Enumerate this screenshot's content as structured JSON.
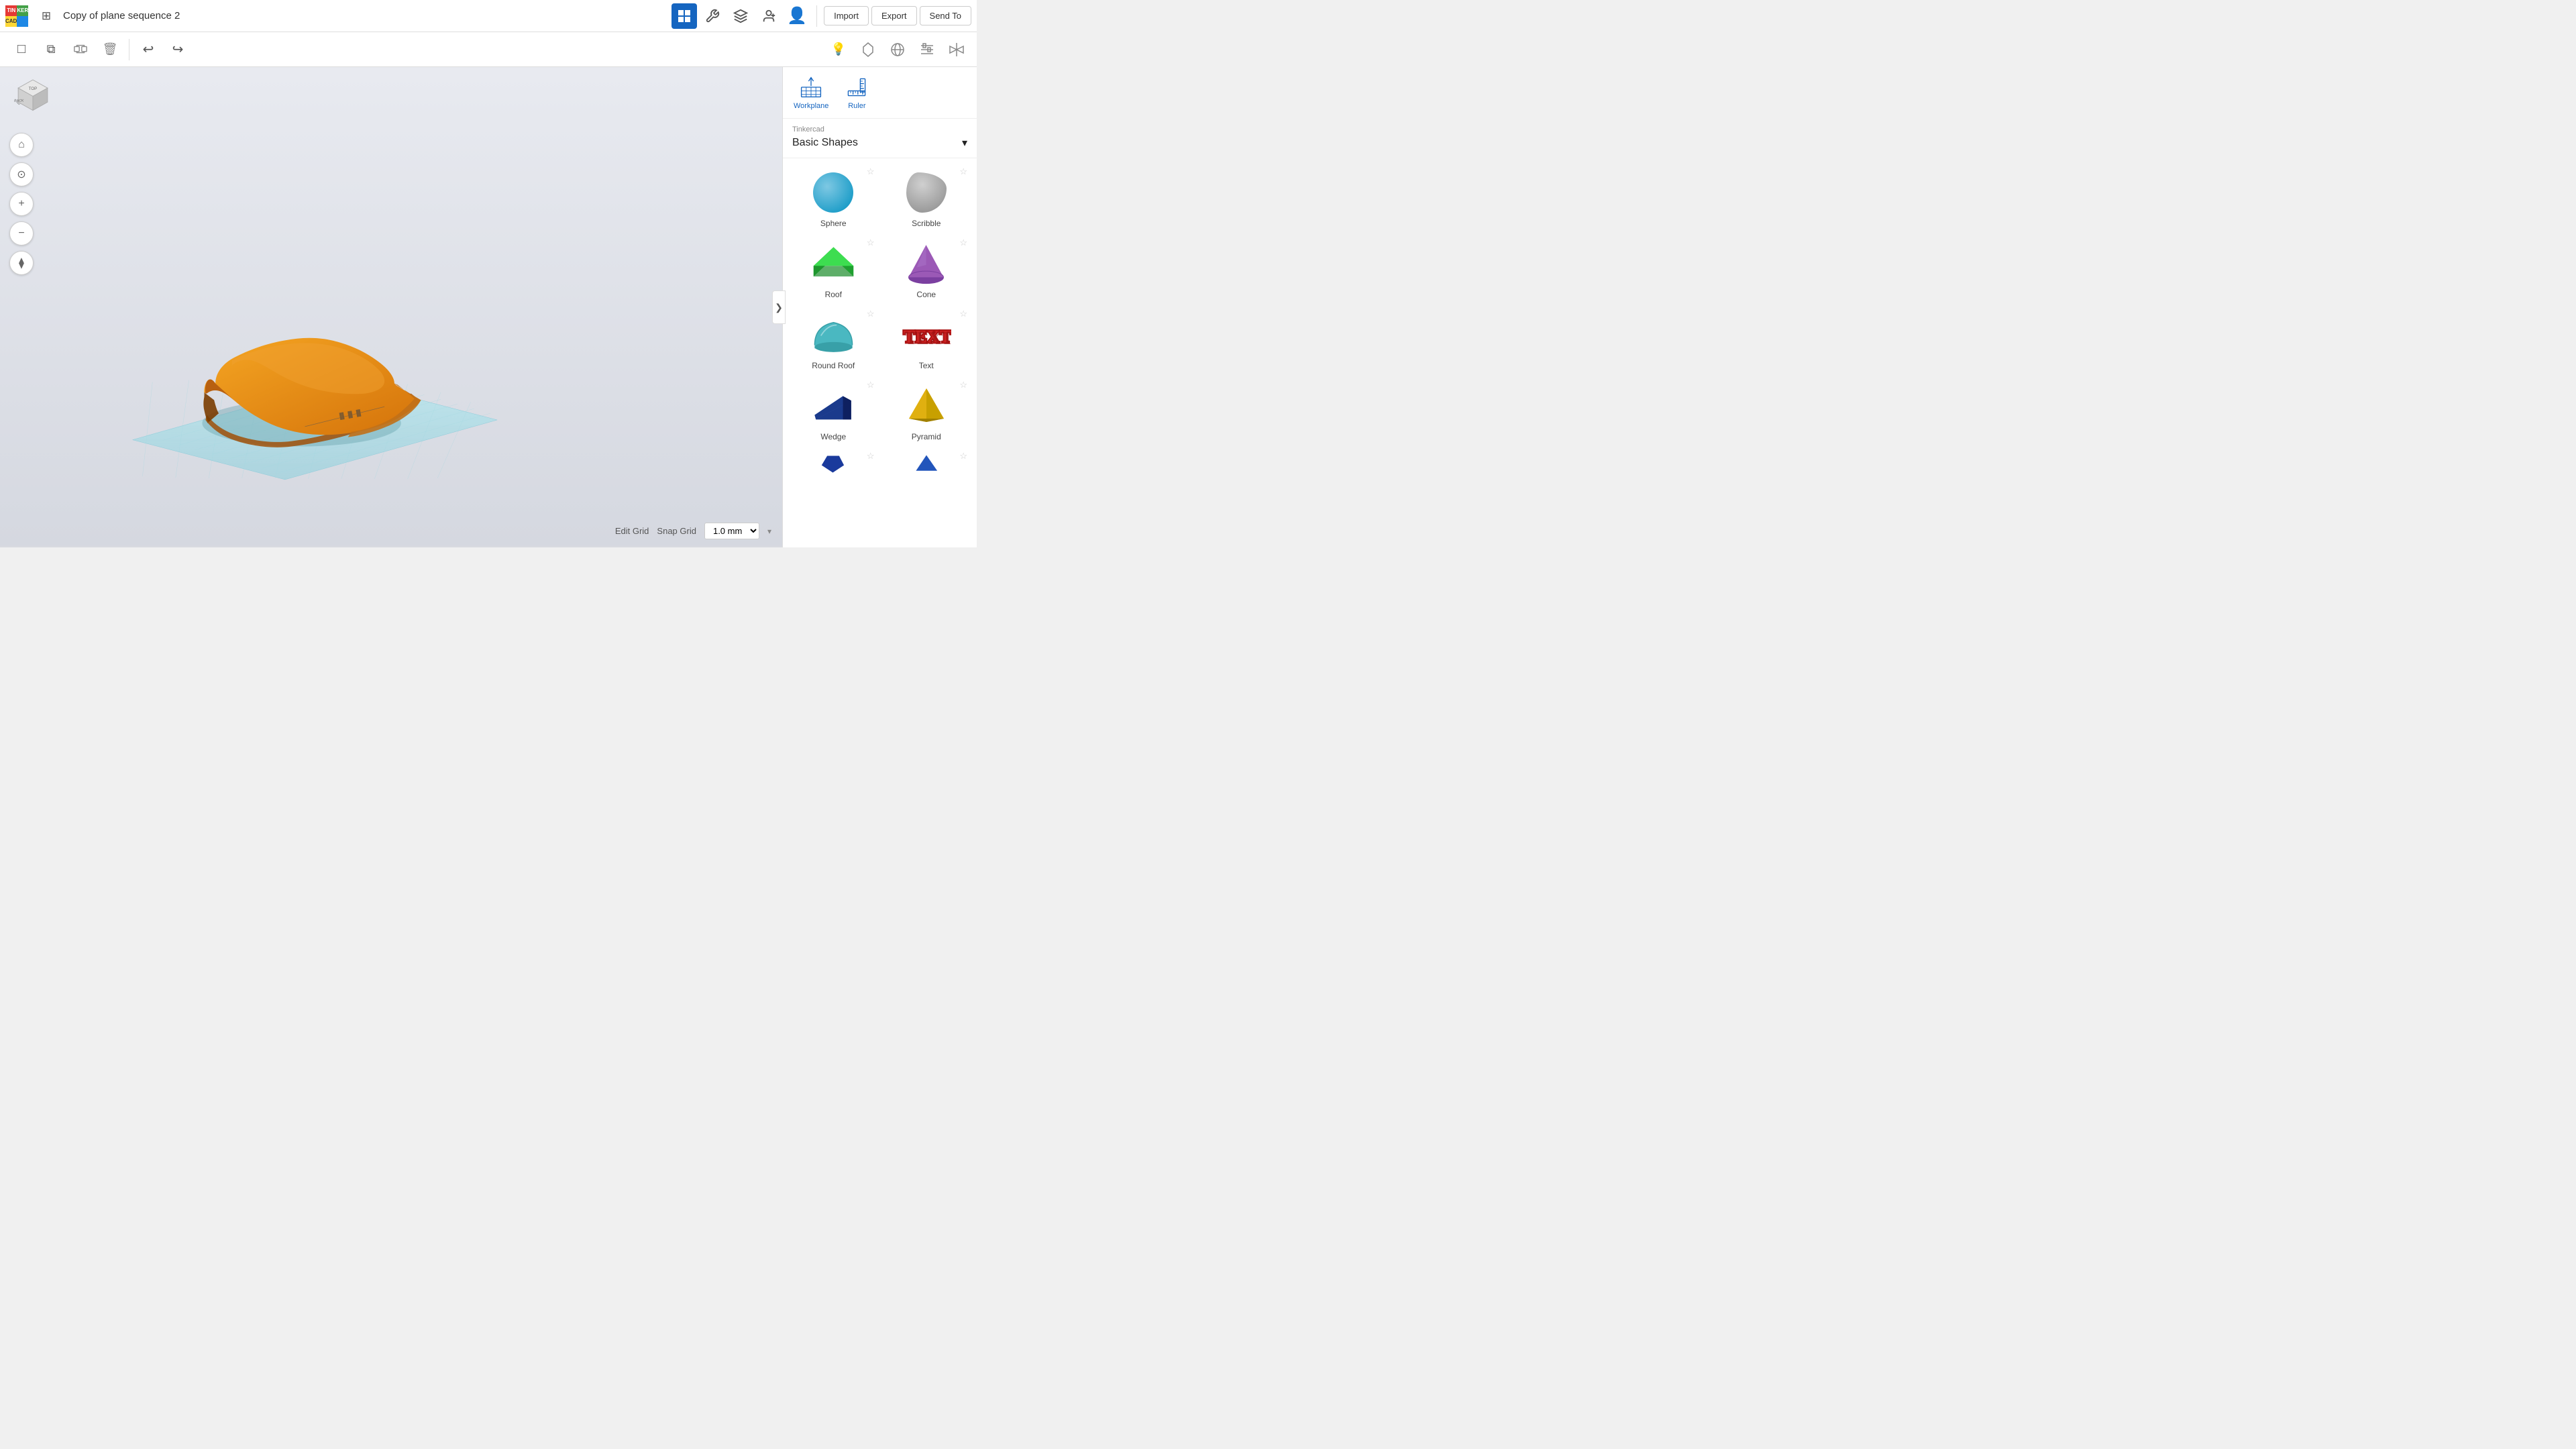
{
  "topbar": {
    "project_title": "Copy of plane sequence 2",
    "import_label": "Import",
    "export_label": "Export",
    "sendto_label": "Send To"
  },
  "toolbar": {
    "group_tooltip": "Group",
    "ungroup_tooltip": "Ungroup",
    "copy_tooltip": "Copy",
    "delete_tooltip": "Delete",
    "undo_tooltip": "Undo",
    "redo_tooltip": "Redo"
  },
  "viewport": {
    "edit_grid_label": "Edit Grid",
    "snap_label": "Snap Grid",
    "snap_value": "1.0 mm"
  },
  "right_panel": {
    "workplane_label": "Workplane",
    "ruler_label": "Ruler",
    "dropdown_sublabel": "Tinkercad",
    "dropdown_main": "Basic Shapes",
    "shapes": [
      {
        "name": "Sphere",
        "type": "sphere"
      },
      {
        "name": "Scribble",
        "type": "scribble"
      },
      {
        "name": "Roof",
        "type": "roof"
      },
      {
        "name": "Cone",
        "type": "cone"
      },
      {
        "name": "Round Roof",
        "type": "round-roof"
      },
      {
        "name": "Text",
        "type": "text-3d"
      },
      {
        "name": "Wedge",
        "type": "wedge"
      },
      {
        "name": "Pyramid",
        "type": "pyramid"
      }
    ]
  },
  "orientation_cube": {
    "top_label": "TOP",
    "back_label": "BACK"
  }
}
